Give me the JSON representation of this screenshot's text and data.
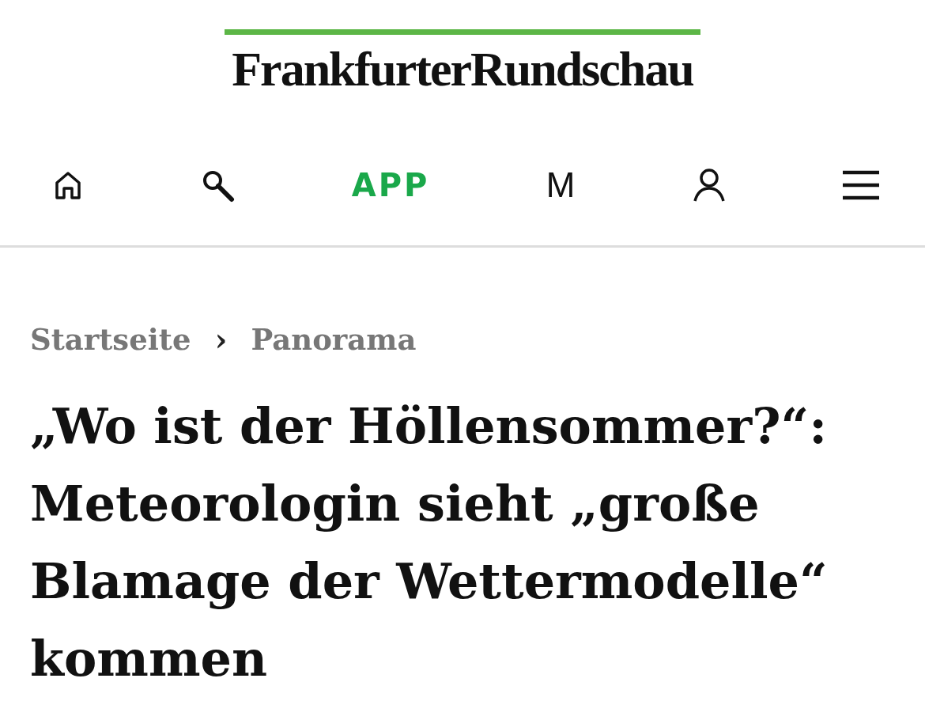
{
  "logo": {
    "text": "FrankfurterRundschau"
  },
  "nav": [
    {
      "kind": "home"
    },
    {
      "kind": "search"
    },
    {
      "kind": "text",
      "label": "APP",
      "accent": true
    },
    {
      "kind": "text",
      "label": "M",
      "accent": false
    },
    {
      "kind": "user"
    },
    {
      "kind": "menu"
    }
  ],
  "breadcrumb": {
    "items": [
      "Startseite",
      "Panorama"
    ],
    "separator": "›"
  },
  "headline": "„Wo ist der Höllensommer?“: Meteorologin sieht „große Blamage der Wettermodelle“ kommen"
}
